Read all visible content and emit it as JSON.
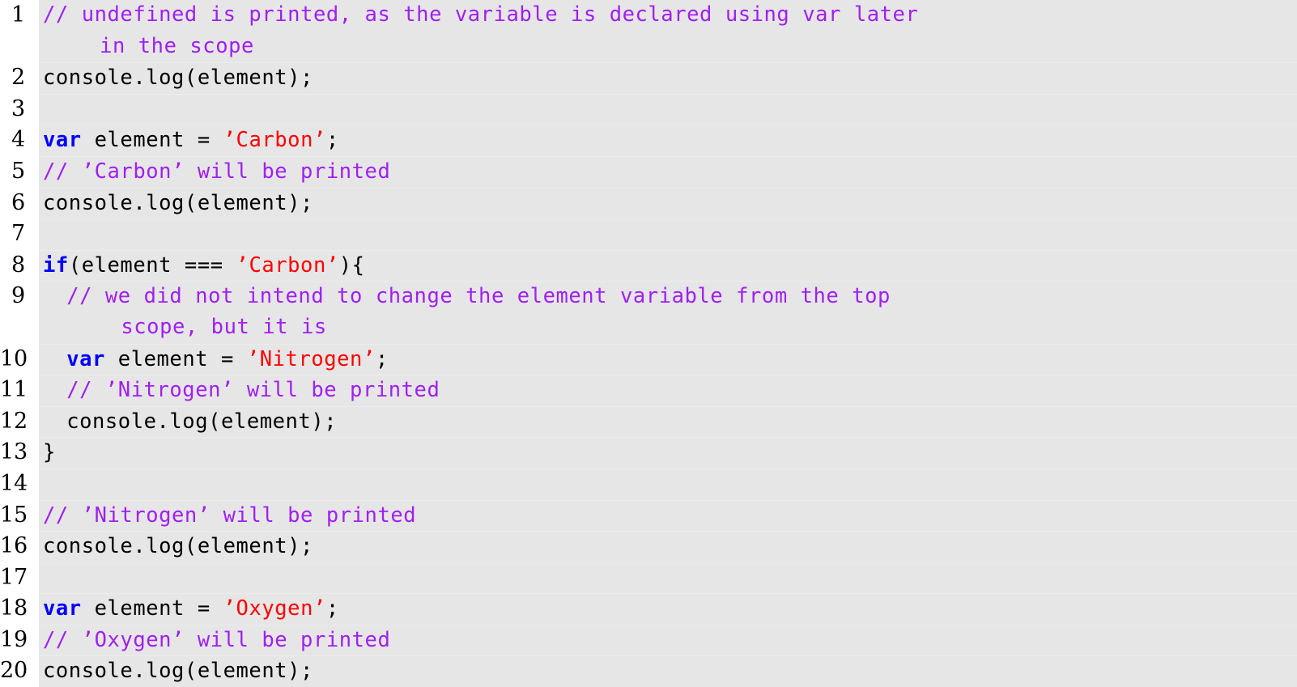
{
  "listing": {
    "language": "JavaScript",
    "colors": {
      "background": "#e6e6e6",
      "row_separator": "#ececec",
      "page_background": "#ffffff",
      "comment": "#a020f0",
      "string": "#ff0000",
      "keyword": "#0000ff",
      "plain": "#000000",
      "line_number": "#000000"
    },
    "lines": [
      {
        "number": "1",
        "rows": [
          {
            "indent": 0,
            "tokens": [
              {
                "type": "cmt",
                "text": "// undefined is printed, as the variable is declared using var later"
              }
            ]
          },
          {
            "indent": 4.8,
            "continuation": true,
            "tokens": [
              {
                "type": "cmt",
                "text": "in the scope"
              }
            ]
          }
        ]
      },
      {
        "number": "2",
        "rows": [
          {
            "indent": 0,
            "tokens": [
              {
                "type": "pln",
                "text": "console.log(element);"
              }
            ]
          }
        ]
      },
      {
        "number": "3",
        "rows": [
          {
            "indent": 0,
            "tokens": [
              {
                "type": "pln",
                "text": ""
              }
            ]
          }
        ]
      },
      {
        "number": "4",
        "rows": [
          {
            "indent": 0,
            "tokens": [
              {
                "type": "kw",
                "text": "var"
              },
              {
                "type": "pln",
                "text": " element = "
              },
              {
                "type": "str",
                "text": "’Carbon’"
              },
              {
                "type": "pln",
                "text": ";"
              }
            ]
          }
        ]
      },
      {
        "number": "5",
        "rows": [
          {
            "indent": 0,
            "tokens": [
              {
                "type": "cmt",
                "text": "// ’Carbon’ will be printed"
              }
            ]
          }
        ]
      },
      {
        "number": "6",
        "rows": [
          {
            "indent": 0,
            "tokens": [
              {
                "type": "pln",
                "text": "console.log(element);"
              }
            ]
          }
        ]
      },
      {
        "number": "7",
        "rows": [
          {
            "indent": 0,
            "tokens": [
              {
                "type": "pln",
                "text": ""
              }
            ]
          }
        ]
      },
      {
        "number": "8",
        "rows": [
          {
            "indent": 0,
            "tokens": [
              {
                "type": "kw",
                "text": "if"
              },
              {
                "type": "pln",
                "text": "(element === "
              },
              {
                "type": "str",
                "text": "’Carbon’"
              },
              {
                "type": "pln",
                "text": "){"
              }
            ]
          }
        ]
      },
      {
        "number": "9",
        "rows": [
          {
            "indent": 2,
            "tokens": [
              {
                "type": "cmt",
                "text": "// we did not intend to change the element variable from the top"
              }
            ]
          },
          {
            "indent": 6.6,
            "continuation": true,
            "tokens": [
              {
                "type": "cmt",
                "text": "scope, but it is"
              }
            ]
          }
        ]
      },
      {
        "number": "10",
        "rows": [
          {
            "indent": 2,
            "tokens": [
              {
                "type": "kw",
                "text": "var"
              },
              {
                "type": "pln",
                "text": " element = "
              },
              {
                "type": "str",
                "text": "’Nitrogen’"
              },
              {
                "type": "pln",
                "text": ";"
              }
            ]
          }
        ]
      },
      {
        "number": "11",
        "rows": [
          {
            "indent": 2,
            "tokens": [
              {
                "type": "cmt",
                "text": "// ’Nitrogen’ will be printed"
              }
            ]
          }
        ]
      },
      {
        "number": "12",
        "rows": [
          {
            "indent": 2,
            "tokens": [
              {
                "type": "pln",
                "text": "console.log(element);"
              }
            ]
          }
        ]
      },
      {
        "number": "13",
        "rows": [
          {
            "indent": 0,
            "tokens": [
              {
                "type": "pln",
                "text": "}"
              }
            ]
          }
        ]
      },
      {
        "number": "14",
        "rows": [
          {
            "indent": 0,
            "tokens": [
              {
                "type": "pln",
                "text": ""
              }
            ]
          }
        ]
      },
      {
        "number": "15",
        "rows": [
          {
            "indent": 0,
            "tokens": [
              {
                "type": "cmt",
                "text": "// ’Nitrogen’ will be printed"
              }
            ]
          }
        ]
      },
      {
        "number": "16",
        "rows": [
          {
            "indent": 0,
            "tokens": [
              {
                "type": "pln",
                "text": "console.log(element);"
              }
            ]
          }
        ]
      },
      {
        "number": "17",
        "rows": [
          {
            "indent": 0,
            "tokens": [
              {
                "type": "pln",
                "text": ""
              }
            ]
          }
        ]
      },
      {
        "number": "18",
        "rows": [
          {
            "indent": 0,
            "tokens": [
              {
                "type": "kw",
                "text": "var"
              },
              {
                "type": "pln",
                "text": " element = "
              },
              {
                "type": "str",
                "text": "’Oxygen’"
              },
              {
                "type": "pln",
                "text": ";"
              }
            ]
          }
        ]
      },
      {
        "number": "19",
        "rows": [
          {
            "indent": 0,
            "tokens": [
              {
                "type": "cmt",
                "text": "// ’Oxygen’ will be printed"
              }
            ]
          }
        ]
      },
      {
        "number": "20",
        "rows": [
          {
            "indent": 0,
            "tokens": [
              {
                "type": "pln",
                "text": "console.log(element);"
              }
            ]
          }
        ]
      }
    ]
  }
}
